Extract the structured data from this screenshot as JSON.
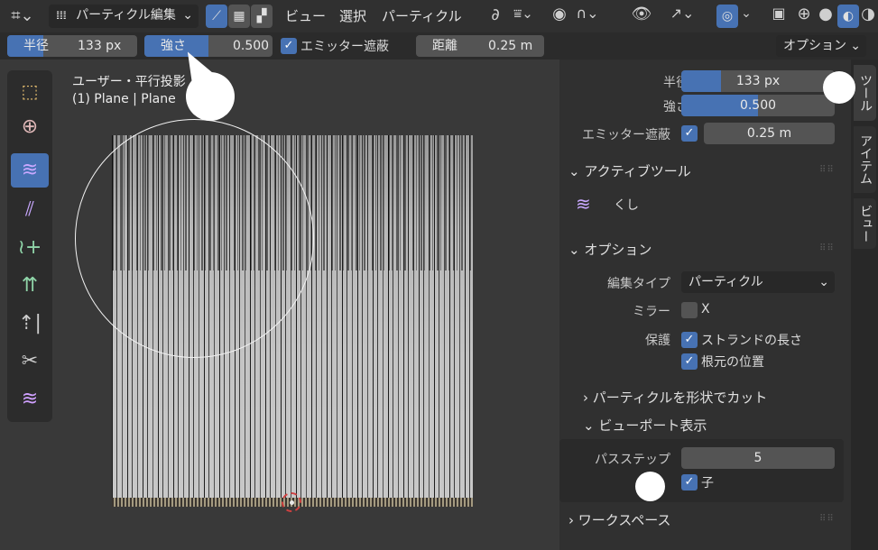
{
  "header": {
    "mode": "パーティクル編集",
    "menus": [
      "ビュー",
      "選択",
      "パーティクル"
    ]
  },
  "toolheader": {
    "radius_label": "半径",
    "radius_value": "133 px",
    "strength_label": "強さ",
    "strength_value": "0.500",
    "emitter_label": "エミッター遮蔽",
    "distance_label": "距離",
    "distance_value": "0.25 m",
    "options": "オプション"
  },
  "viewport": {
    "view_name": "ユーザー・平行投影",
    "object_name": "(1) Plane | Plane"
  },
  "sidebar": {
    "radius_label": "半径",
    "radius_value": "133 px",
    "strength_label": "強さ",
    "strength_value": "0.500",
    "emitter_label": "エミッター遮蔽",
    "emitter_value": "0.25 m",
    "active_tool_header": "アクティブツール",
    "tool_name": "くし",
    "options_header": "オプション",
    "edit_type_label": "編集タイプ",
    "edit_type_value": "パーティクル",
    "mirror_label": "ミラー",
    "mirror_x": "X",
    "protect_label": "保護",
    "protect_strand": "ストランドの長さ",
    "protect_root": "根元の位置",
    "cut_header": "パーティクルを形状でカット",
    "viewport_header": "ビューポート表示",
    "path_steps_label": "パスステップ",
    "path_steps_value": "5",
    "child_label": "子",
    "workspace_header": "ワークスペース"
  },
  "tabs": [
    "ツール",
    "アイテム",
    "ビュー"
  ],
  "progress": {
    "strength_fraction": 0.5,
    "radius_fraction": 0.27
  },
  "colors": {
    "accent": "#4772b3",
    "panel": "#303030",
    "field": "#545454"
  }
}
